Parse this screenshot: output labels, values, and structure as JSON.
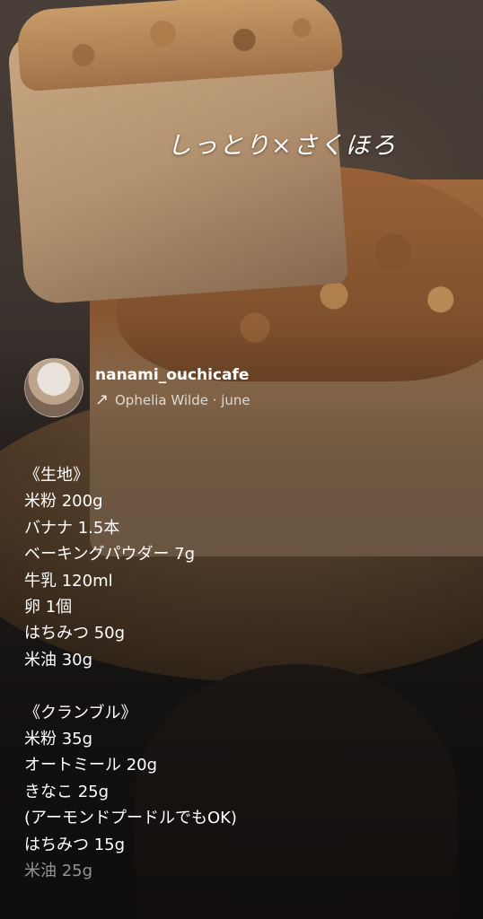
{
  "overlay_text": "しっとり×さくほろ",
  "post": {
    "username": "nanami_ouchicafe",
    "music_icon": "arrow-up-right-icon",
    "music_line": "Ophelia Wilde · june"
  },
  "caption": {
    "dough_heading": "《生地》",
    "dough_items": [
      "米粉 200g",
      "バナナ 1.5本",
      "ベーキングパウダー 7g",
      "牛乳 120ml",
      "卵 1個",
      "はちみつ 50g",
      "米油 30g"
    ],
    "crumble_heading": "《クランブル》",
    "crumble_items": [
      "米粉 35g",
      "オートミール 20g",
      "きなこ 25g",
      "(アーモンドプードルでもOK)",
      "はちみつ 15g",
      "米油 25g"
    ]
  }
}
